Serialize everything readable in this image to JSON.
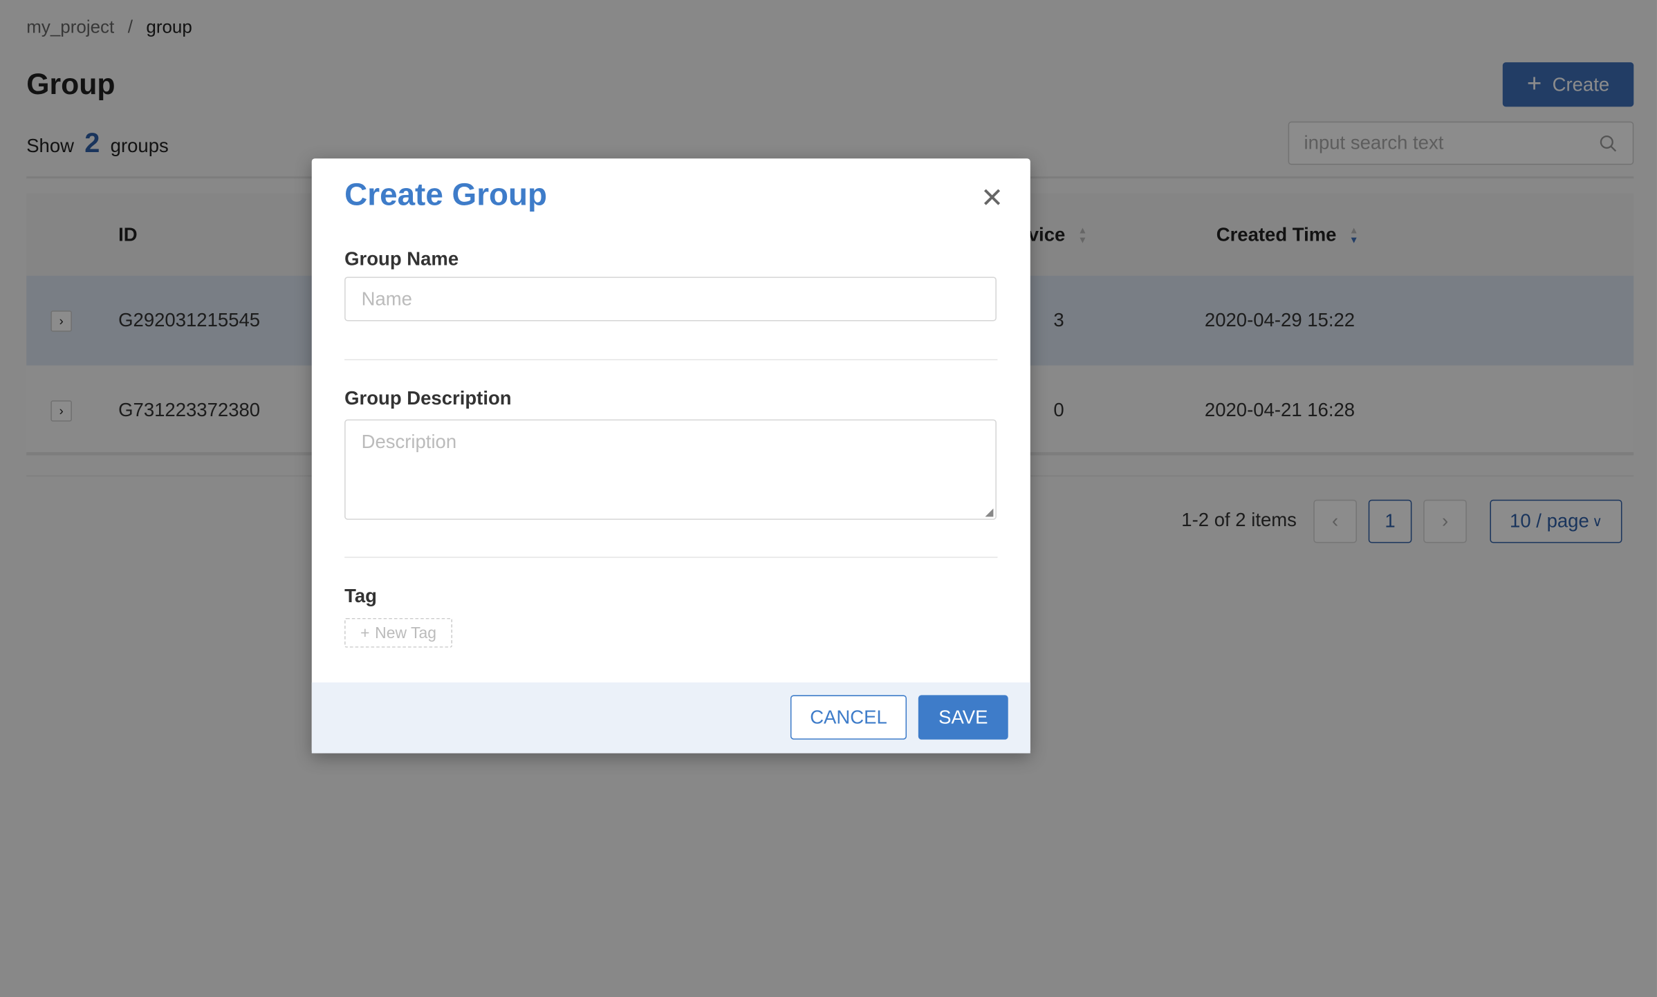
{
  "breadcrumb": {
    "parent": "my_project",
    "separator": "/",
    "current": "group"
  },
  "page": {
    "title": "Group",
    "show_prefix": "Show",
    "count": "2",
    "show_suffix": "groups",
    "create_label": "Create",
    "search_placeholder": "input search text"
  },
  "table": {
    "columns": [
      "ID",
      "Device",
      "Created Time"
    ],
    "rows": [
      {
        "id": "G292031215545",
        "device": "3",
        "created": "2020-04-29 15:22"
      },
      {
        "id": "G731223372380",
        "device": "0",
        "created": "2020-04-21 16:28"
      }
    ]
  },
  "pagination": {
    "summary": "1-2 of 2 items",
    "current_page": "1",
    "page_size": "10 / page"
  },
  "modal": {
    "title": "Create Group",
    "name_label": "Group Name",
    "name_placeholder": "Name",
    "desc_label": "Group Description",
    "desc_placeholder": "Description",
    "tag_label": "Tag",
    "new_tag": "New Tag",
    "cancel": "CANCEL",
    "save": "SAVE"
  },
  "colors": {
    "accent": "#3e7cc9",
    "primary_button": "#3e6fb9"
  }
}
